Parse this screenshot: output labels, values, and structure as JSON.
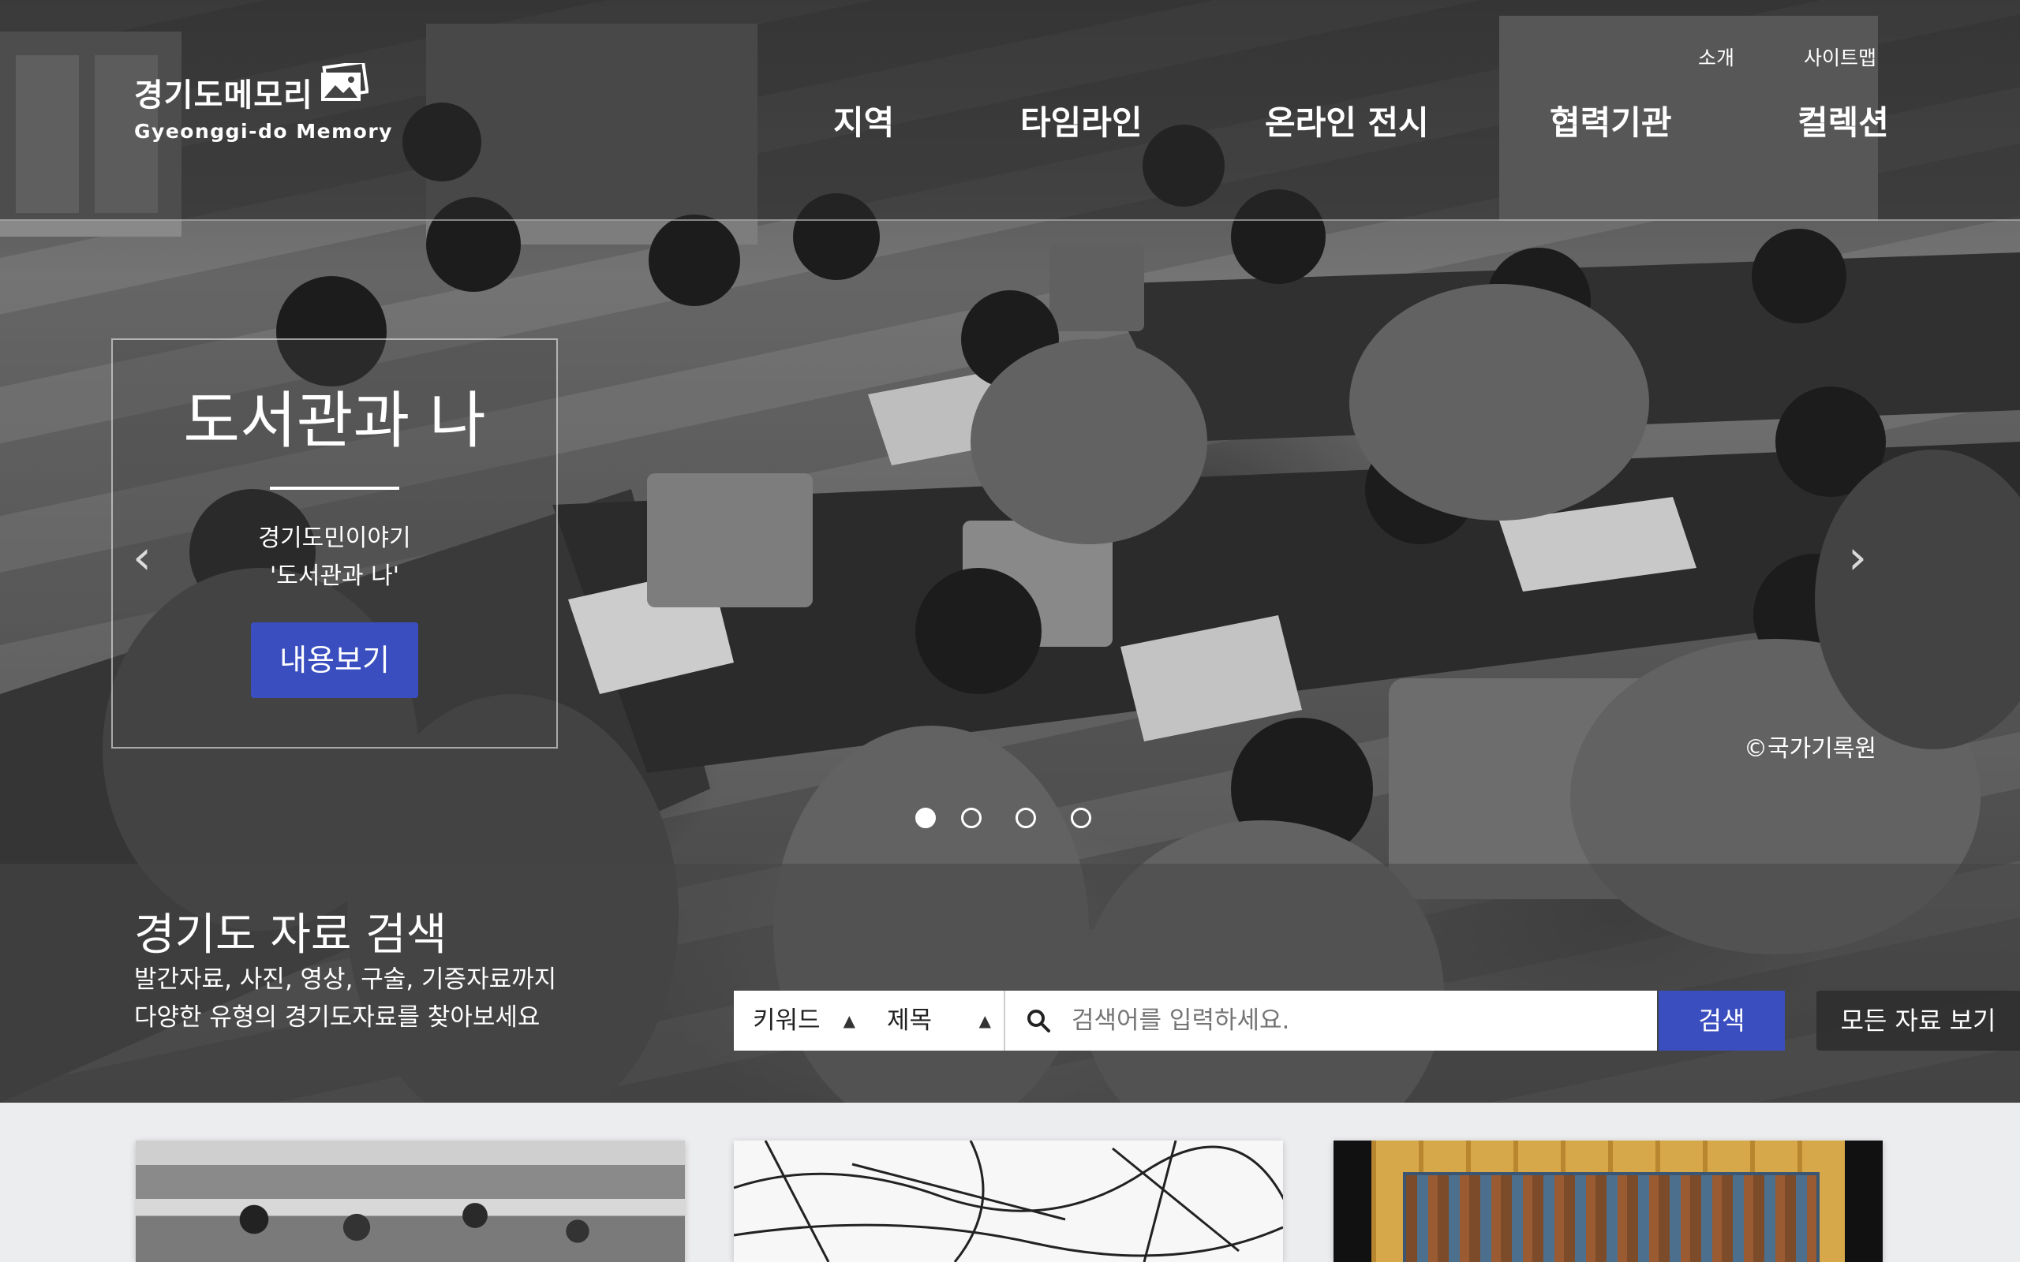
{
  "header": {
    "logo": {
      "title_kr": "경기도메모리",
      "title_en": "Gyeonggi-do Memory"
    },
    "util_links": [
      "소개",
      "사이트맵"
    ],
    "nav": [
      "지역",
      "타임라인",
      "온라인 전시",
      "협력기관",
      "컬렉션"
    ]
  },
  "hero": {
    "slide": {
      "title": "도서관과 나",
      "desc_line1": "경기도민이야기",
      "desc_line2": "'도서관과 나'",
      "button": "내용보기"
    },
    "credit": "©국가기록원",
    "slide_count": 4,
    "active_slide": 1
  },
  "search": {
    "title": "경기도 자료 검색",
    "desc_line1": "발간자료, 사진, 영상, 구술, 기증자료까지",
    "desc_line2": "다양한 유형의 경기도자료를 찾아보세요",
    "select_type": "키워드",
    "select_field": "제목",
    "placeholder": "검색어를 입력하세요.",
    "button": "검색",
    "all_button": "모든 자료 보기"
  },
  "colors": {
    "accent": "#3a4ec0"
  }
}
